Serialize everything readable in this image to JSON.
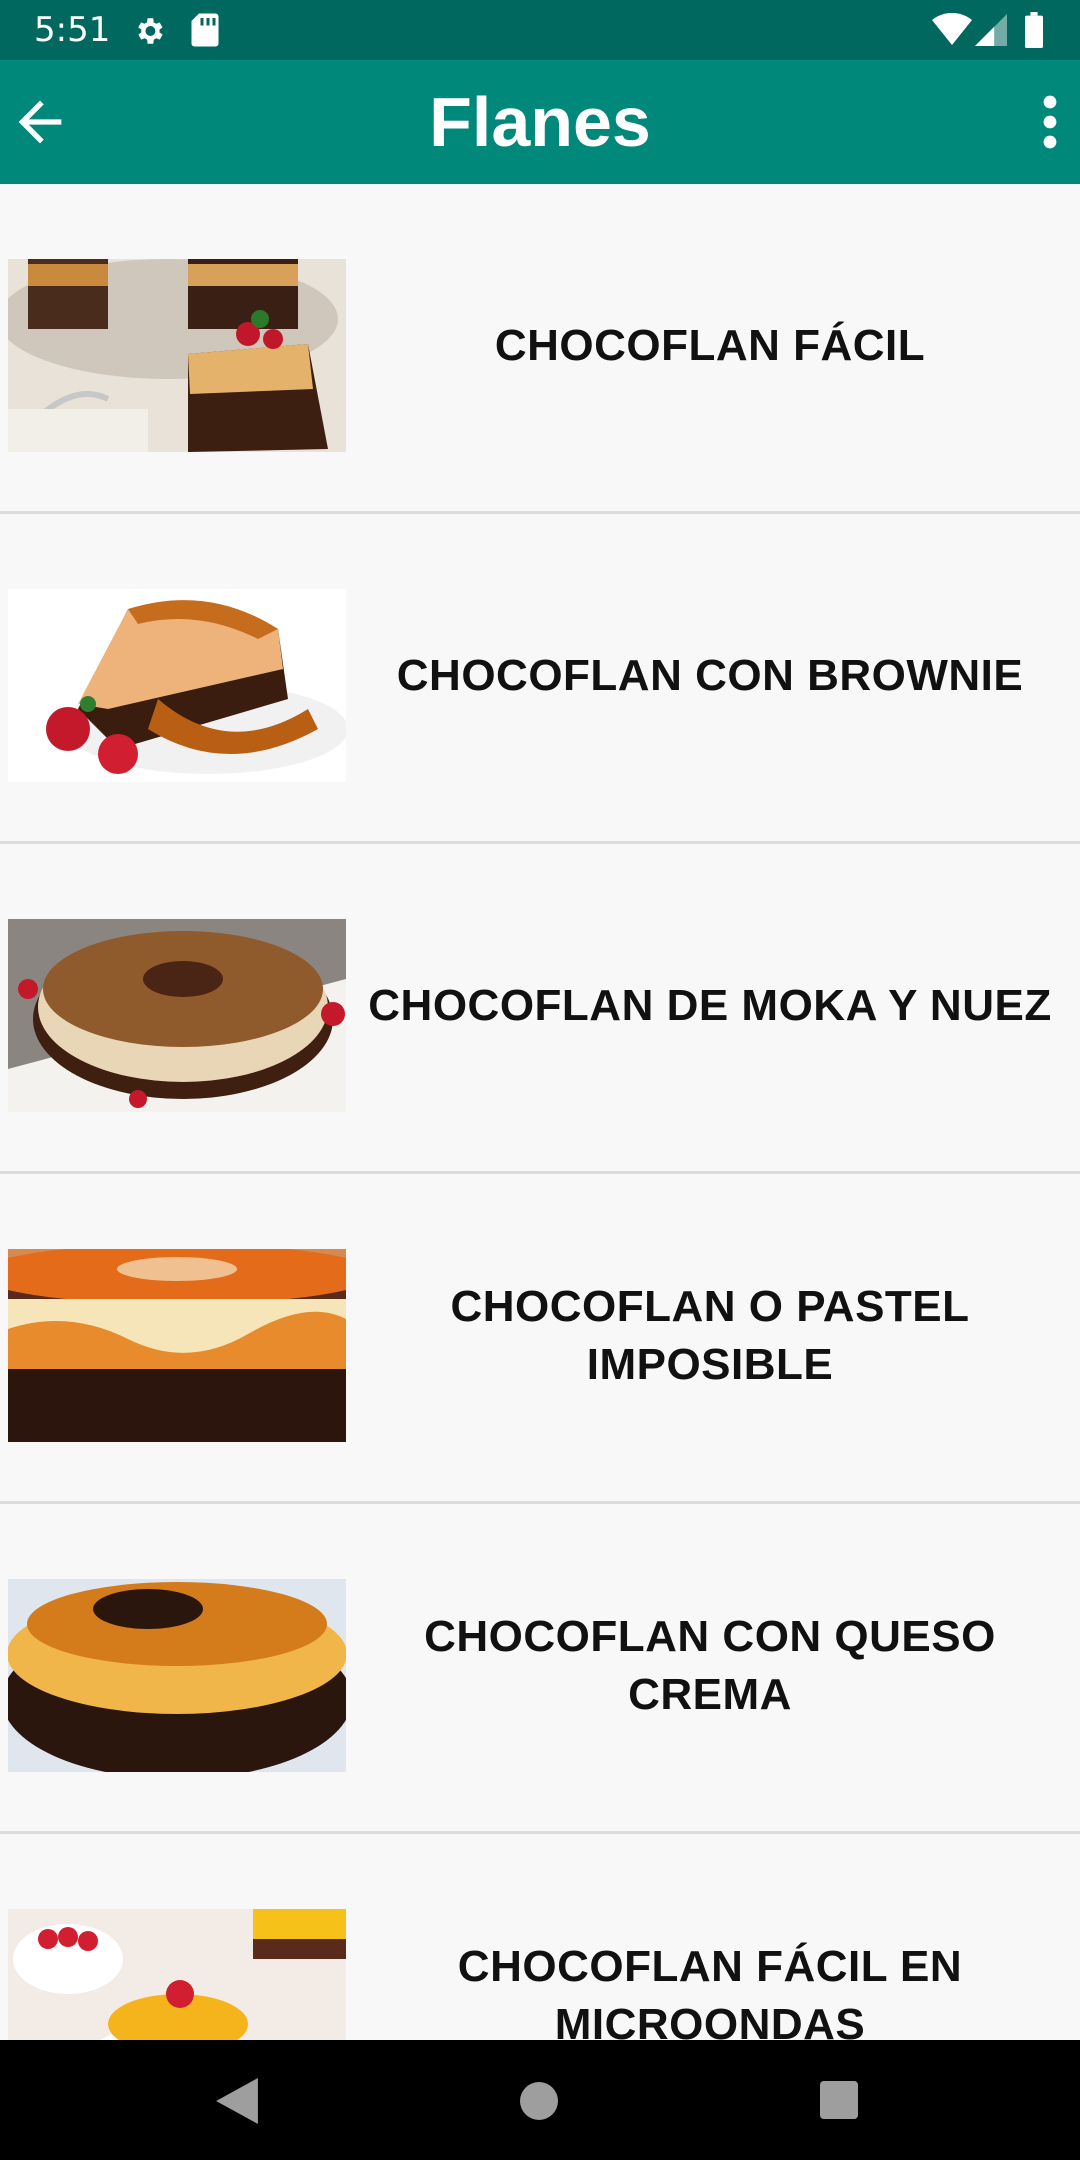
{
  "status_bar": {
    "time": "5:51",
    "icons": [
      "settings-icon",
      "sd-card-icon",
      "wifi-icon",
      "signal-icon",
      "battery-icon"
    ]
  },
  "app_bar": {
    "title": "Flanes",
    "back_icon": "arrow-back-icon",
    "menu_icon": "more-vert-icon",
    "color": "#00897b",
    "status_color": "#00685e"
  },
  "recipes": [
    {
      "title": "CHOCOFLAN FÁCIL"
    },
    {
      "title": "CHOCOFLAN CON BROWNIE"
    },
    {
      "title": "CHOCOFLAN DE MOKA Y NUEZ"
    },
    {
      "title": "CHOCOFLAN O PASTEL IMPOSIBLE"
    },
    {
      "title": "CHOCOFLAN CON QUESO CREMA"
    },
    {
      "title": "CHOCOFLAN FÁCIL EN MICROONDAS"
    }
  ],
  "nav_bar": {
    "icons": [
      "nav-back-icon",
      "nav-home-icon",
      "nav-recents-icon"
    ]
  }
}
